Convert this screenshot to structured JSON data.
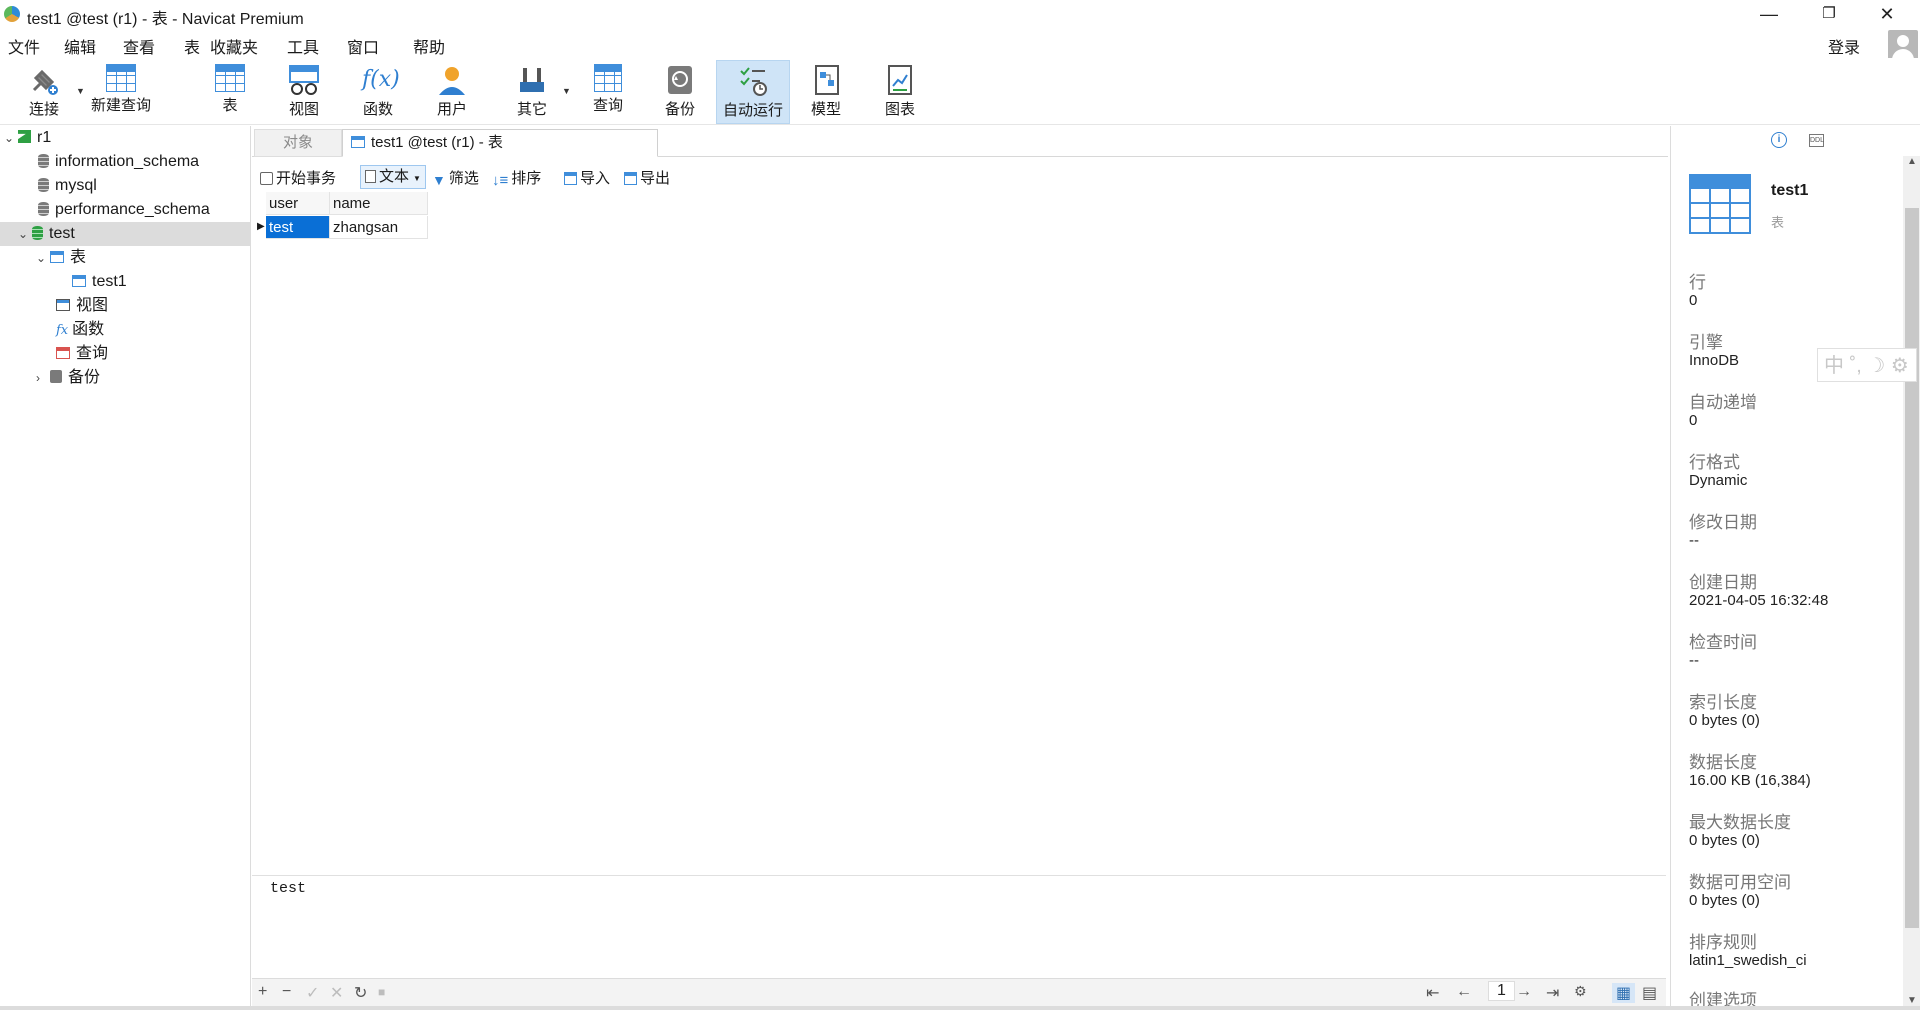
{
  "window": {
    "title": "test1 @test (r1) - 表 - Navicat Premium",
    "minimize": "—",
    "restore": "❐",
    "close": "✕"
  },
  "menu": {
    "items": [
      "文件",
      "编辑",
      "查看",
      "表",
      "收藏夹",
      "工具",
      "窗口",
      "帮助"
    ],
    "login": "登录"
  },
  "toolbar": {
    "items": [
      {
        "label": "连接",
        "icon": "connect-icon"
      },
      {
        "label": "新建查询",
        "icon": "new-query-icon"
      },
      {
        "label": "表",
        "icon": "table-icon"
      },
      {
        "label": "视图",
        "icon": "view-icon"
      },
      {
        "label": "函数",
        "icon": "function-icon"
      },
      {
        "label": "用户",
        "icon": "user-icon"
      },
      {
        "label": "其它",
        "icon": "tools-icon"
      },
      {
        "label": "查询",
        "icon": "query-icon"
      },
      {
        "label": "备份",
        "icon": "backup-icon"
      },
      {
        "label": "自动运行",
        "icon": "automation-icon",
        "active": true
      },
      {
        "label": "模型",
        "icon": "model-icon"
      },
      {
        "label": "图表",
        "icon": "chart-icon"
      }
    ]
  },
  "tree": {
    "connection": "r1",
    "databases": [
      "information_schema",
      "mysql",
      "performance_schema",
      "test"
    ],
    "test_children": {
      "tables_label": "表",
      "table": "test1",
      "views_label": "视图",
      "functions_label": "函数",
      "queries_label": "查询",
      "backups_label": "备份"
    }
  },
  "tabs": {
    "objects": "对象",
    "active": "test1 @test (r1) - 表"
  },
  "subtoolbar": {
    "begin_transaction": "开始事务",
    "text": "文本",
    "filter": "筛选",
    "sort": "排序",
    "import": "导入",
    "export": "导出"
  },
  "grid": {
    "columns": [
      "user",
      "name"
    ],
    "rows": [
      [
        "test",
        "zhangsan"
      ]
    ]
  },
  "editor": {
    "value": "test"
  },
  "bottombar": {
    "add": "+",
    "remove": "−",
    "apply": "✓",
    "discard": "✕",
    "refresh": "↻",
    "stop": "■",
    "first": "⇤",
    "prev": "←",
    "page": "1",
    "next": "→",
    "last": "⇥",
    "settings": "⚙",
    "grid_view": "▦",
    "form_view": "▤"
  },
  "info_panel": {
    "info_icon": "i",
    "ddl_icon": "DDL",
    "name": "test1",
    "type": "表",
    "properties": [
      {
        "label": "行",
        "value": "0"
      },
      {
        "label": "引擎",
        "value": "InnoDB"
      },
      {
        "label": "自动递增",
        "value": "0"
      },
      {
        "label": "行格式",
        "value": "Dynamic"
      },
      {
        "label": "修改日期",
        "value": "--"
      },
      {
        "label": "创建日期",
        "value": "2021-04-05 16:32:48"
      },
      {
        "label": "检查时间",
        "value": "--"
      },
      {
        "label": "索引长度",
        "value": "0 bytes (0)"
      },
      {
        "label": "数据长度",
        "value": "16.00 KB (16,384)"
      },
      {
        "label": "最大数据长度",
        "value": "0 bytes (0)"
      },
      {
        "label": "数据可用空间",
        "value": "0 bytes (0)"
      },
      {
        "label": "排序规则",
        "value": "latin1_swedish_ci"
      },
      {
        "label": "创建选项",
        "value": ""
      }
    ]
  },
  "ime": {
    "text": "中 ˚, ☽ ⚙"
  },
  "colors": {
    "accent": "#0a6fd6",
    "table_blue": "#3f8edb",
    "active_tool_bg": "#cfe4f7",
    "selected_tree_bg": "#dcdcdc"
  }
}
